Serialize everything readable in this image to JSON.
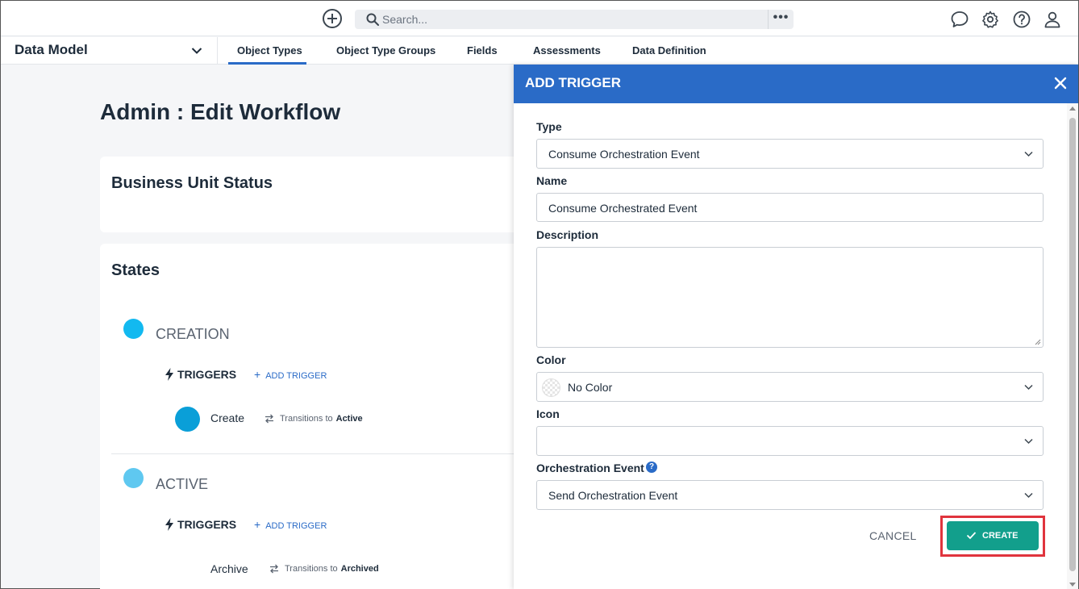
{
  "topbar": {
    "search_placeholder": "Search...",
    "more_label": "•••",
    "icons": [
      "add-circle-icon",
      "search-icon",
      "chat-icon",
      "gear-icon",
      "help-icon",
      "user-icon"
    ]
  },
  "subnav": {
    "module": "Data Model",
    "tabs": [
      {
        "label": "Object Types",
        "active": true
      },
      {
        "label": "Object Type Groups"
      },
      {
        "label": "Fields"
      },
      {
        "label": "Assessments"
      },
      {
        "label": "Data Definition"
      }
    ]
  },
  "page": {
    "title": "Admin : Edit Workflow",
    "workflow_name": "Business Unit Status",
    "states_title": "States",
    "states": [
      {
        "name": "CREATION",
        "color": "#12b9f0",
        "triggers_label": "TRIGGERS",
        "add_trigger_label": "ADD TRIGGER",
        "triggers": [
          {
            "name": "Create",
            "color": "#0a9fd8",
            "transition_text": "Transitions to",
            "target": "Active"
          }
        ]
      },
      {
        "name": "ACTIVE",
        "color": "#5fc8f0",
        "triggers_label": "TRIGGERS",
        "add_trigger_label": "ADD TRIGGER",
        "triggers": [
          {
            "name": "Archive",
            "transition_text": "Transitions to",
            "target": "Archived"
          }
        ]
      }
    ]
  },
  "panel": {
    "title": "ADD TRIGGER",
    "header_color": "#2a6bc7",
    "fields": {
      "type": {
        "label": "Type",
        "value": "Consume Orchestration Event"
      },
      "name": {
        "label": "Name",
        "value": "Consume Orchestrated Event"
      },
      "description": {
        "label": "Description",
        "value": ""
      },
      "color": {
        "label": "Color",
        "value": "No Color"
      },
      "icon": {
        "label": "Icon",
        "value": ""
      },
      "orchestration_event": {
        "label": "Orchestration Event",
        "value": "Send Orchestration Event",
        "help": "?"
      }
    },
    "cancel_label": "CANCEL",
    "create_label": "CREATE",
    "create_color": "#129f8c",
    "highlight_color": "#e0343d"
  }
}
